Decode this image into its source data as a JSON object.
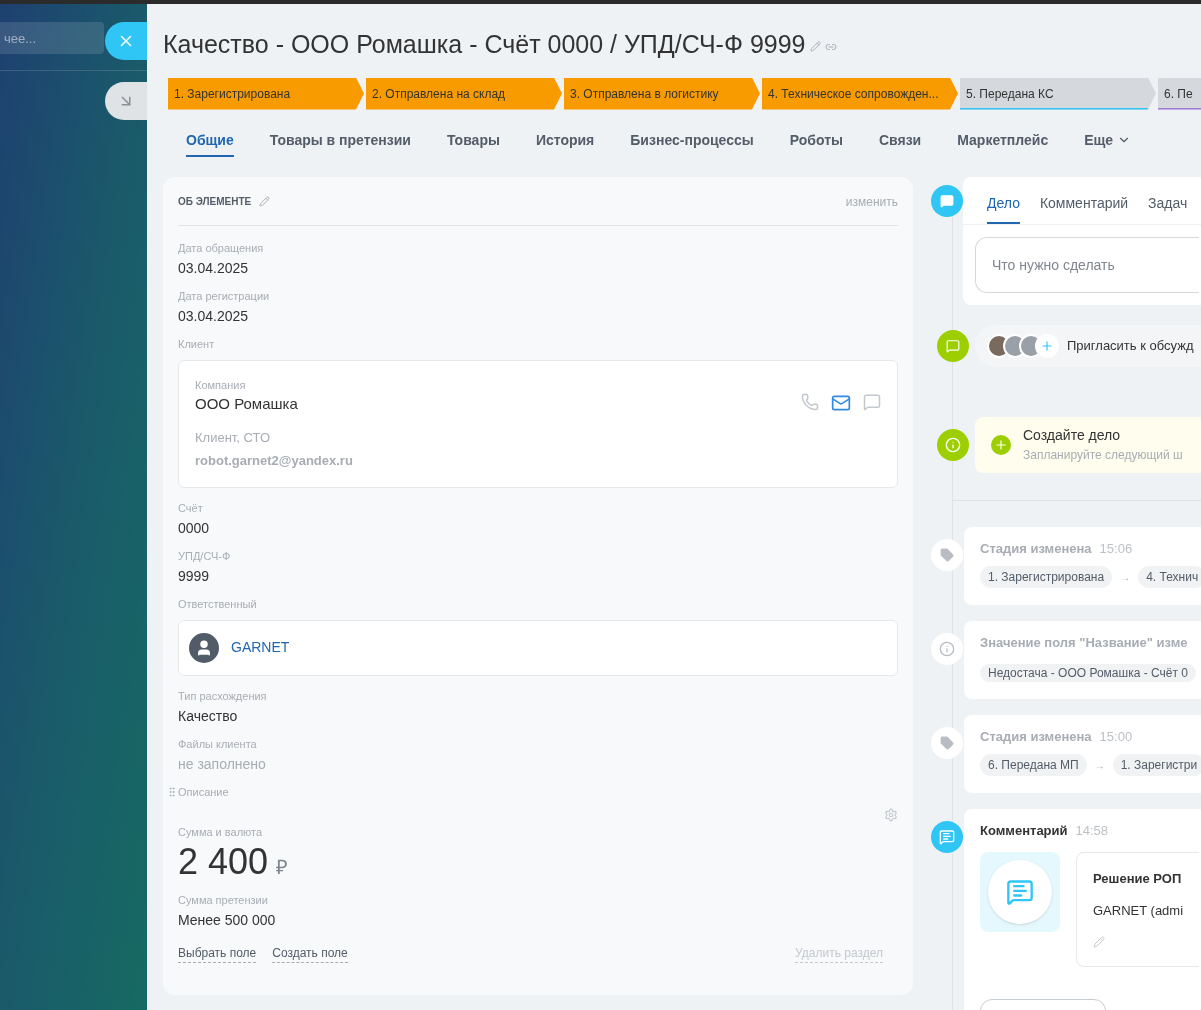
{
  "background": {
    "search": {
      "placeholder": "чее..."
    }
  },
  "title": "Качество - ООО Ромашка - Счёт 0000 / УПД/СЧ-Ф 9999",
  "stages": [
    {
      "label": "1. Зарегистрирована",
      "color": "#f89b00"
    },
    {
      "label": "2. Отправлена на склад",
      "color": "#f89b00"
    },
    {
      "label": "3. Отправлена в логистику",
      "color": "#f89b00"
    },
    {
      "label": "4. Техническое сопровожден...",
      "color": "#f89b00"
    },
    {
      "label": "5. Передана КС",
      "color": "#d5d8dd",
      "underline": {
        "color": "#2fc6f6"
      }
    },
    {
      "label": "6. Пе",
      "color": "#d5d8dd",
      "underline": {
        "color": "#a47ad6"
      }
    }
  ],
  "tabs": [
    {
      "label": "Общие",
      "selected": true
    },
    {
      "label": "Товары в претензии",
      "selected": false
    },
    {
      "label": "Товары",
      "selected": false
    },
    {
      "label": "История",
      "selected": false
    },
    {
      "label": "Бизнес-процессы",
      "selected": false
    },
    {
      "label": "Роботы",
      "selected": false
    },
    {
      "label": "Связи",
      "selected": false
    },
    {
      "label": "Маркетплейс",
      "selected": false
    },
    {
      "label": "Еще",
      "selected": false
    }
  ],
  "card": {
    "title": "ОБ ЭЛЕМЕНТЕ",
    "edit_link": "изменить",
    "fields": [
      {
        "kind": "text",
        "label": "Дата обращения",
        "value": "03.04.2025"
      },
      {
        "kind": "text",
        "label": "Дата регистрации",
        "value": "03.04.2025"
      },
      {
        "kind": "client",
        "label": "Клиент",
        "company_label": "Компания",
        "company": "ООО Ромашка",
        "role": "Клиент, СТО",
        "email": "robot.garnet2@yandex.ru"
      },
      {
        "kind": "text",
        "label": "Счёт",
        "value": "0000"
      },
      {
        "kind": "text",
        "label": "УПД/СЧ-Ф",
        "value": "9999"
      },
      {
        "kind": "user",
        "label": "Ответственный",
        "value": "GARNET"
      },
      {
        "kind": "text",
        "label": "Тип расхождения",
        "value": "Качество"
      },
      {
        "kind": "empty",
        "label": "Файлы клиента",
        "value": "не заполнено"
      },
      {
        "kind": "draggable",
        "label": "Описание"
      },
      {
        "kind": "money",
        "label": "Сумма и валюта",
        "value": "2 400",
        "currency": "₽"
      },
      {
        "kind": "text",
        "label": "Сумма претензии",
        "value": "Менее 500 000"
      }
    ],
    "footer_links": [
      "Выбрать поле",
      "Создать поле"
    ],
    "delete_link": "Удалить раздел"
  },
  "timeline": {
    "composer": {
      "tabs": [
        {
          "label": "Дело",
          "selected": true
        },
        {
          "label": "Комментарий",
          "selected": false
        },
        {
          "label": "Задач",
          "selected": false
        }
      ],
      "placeholder": "Что нужно сделать"
    },
    "invite": "Пригласить к обсужд",
    "hint": {
      "title": "Создайте дело",
      "subtitle": "Запланируйте следующий ш"
    },
    "events": [
      {
        "kind": "stage",
        "title": "Стадия изменена",
        "time": "15:06",
        "from": "1. Зарегистрирована",
        "arrow": "→",
        "to": "4. Технич"
      },
      {
        "kind": "field",
        "title": "Значение поля \"Название\" изме",
        "value": "Недостача - ООО Ромашка - Счёт 0"
      },
      {
        "kind": "stage",
        "title": "Стадия изменена",
        "time": "15:00",
        "from": "6. Передана МП",
        "arrow": "→",
        "to": "1. Зарегистри"
      },
      {
        "kind": "comment",
        "title": "Комментарий",
        "time": "14:58",
        "heading": "Решение РОП",
        "author": "GARNET (admi"
      }
    ]
  }
}
